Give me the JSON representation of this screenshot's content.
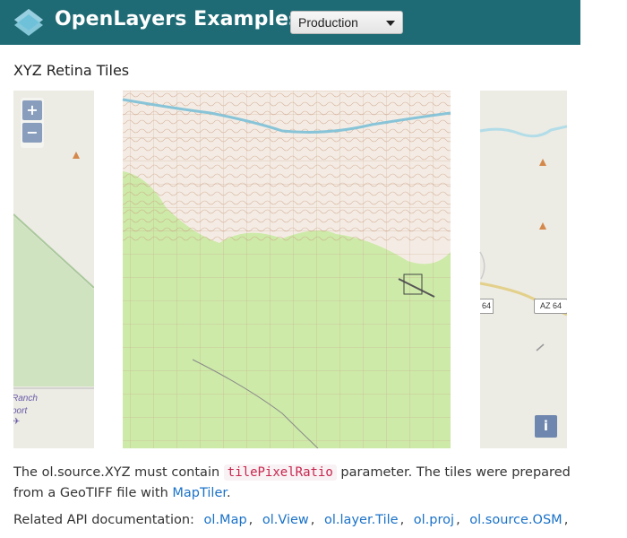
{
  "header": {
    "brand": "OpenLayers Examples",
    "version_select": "Production",
    "logo_icon": "openlayers-logo-icon"
  },
  "example": {
    "title": "XYZ Retina Tiles"
  },
  "map": {
    "zoom_in": "+",
    "zoom_out": "−",
    "attribution": "i",
    "labels": {
      "ranch": "Ranch",
      "port": "port"
    },
    "route_shield": "AZ 64",
    "route_shield_partial": "64",
    "colors": {
      "forest": "#cdeaa8",
      "grid": "#d68b70",
      "water": "#88c4d8",
      "basemap": "#ecebe4"
    }
  },
  "description": {
    "part1": "The ol.source.XYZ must contain ",
    "code": "tilePixelRatio",
    "part2": " parameter. The tiles were prepared from a GeoTIFF file with ",
    "link": "MapTiler",
    "part3": "."
  },
  "api_docs": {
    "label": "Related API documentation:",
    "links": [
      "ol.Map",
      "ol.View",
      "ol.layer.Tile",
      "ol.proj",
      "ol.source.OSM"
    ]
  }
}
